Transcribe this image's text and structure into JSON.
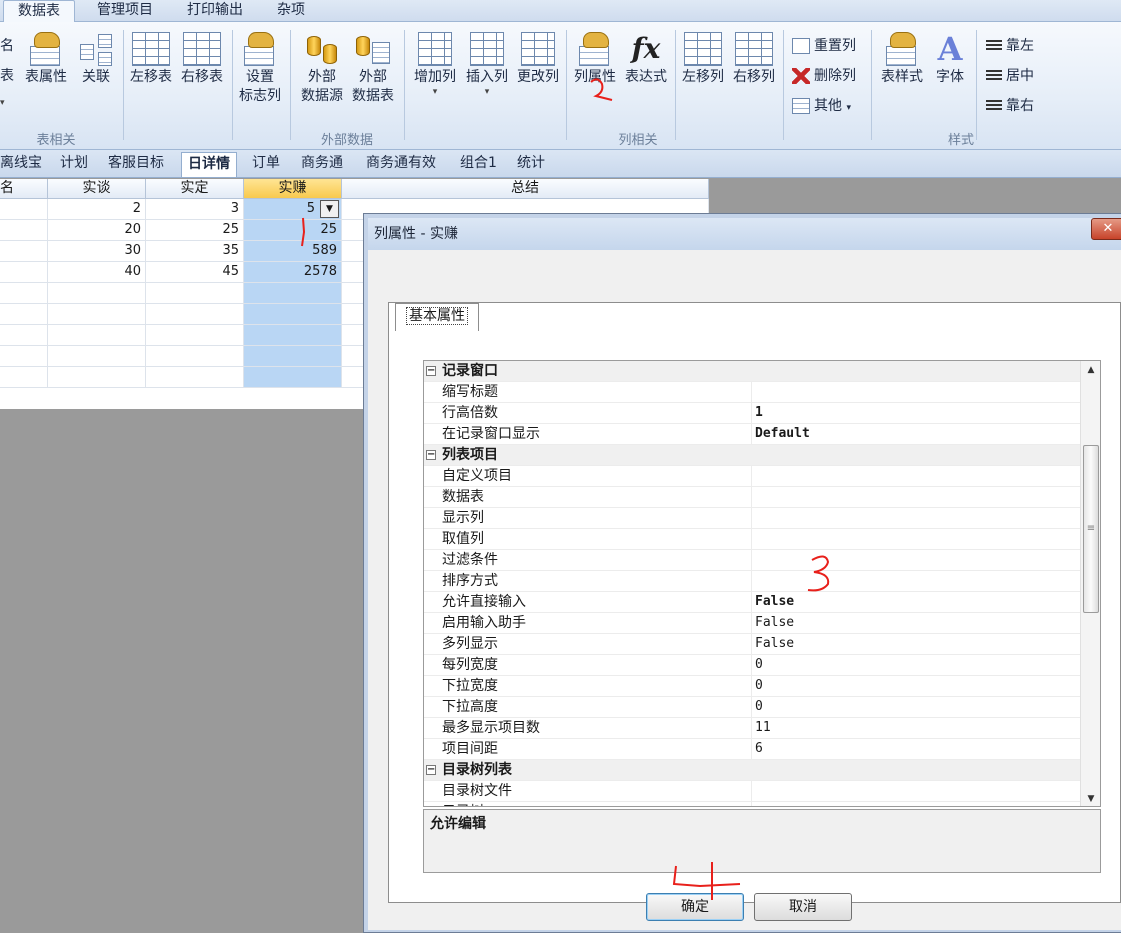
{
  "ribbon_tabs": [
    {
      "label": "数据表",
      "active": true
    },
    {
      "label": "管理项目",
      "active": false
    },
    {
      "label": "打印输出",
      "active": false
    },
    {
      "label": "杂项",
      "active": false
    }
  ],
  "ribbon": {
    "table_group": {
      "truncated_top": "名",
      "truncated_mid": "表",
      "props": "表属性",
      "link": "关联",
      "move_left": "左移表",
      "move_right": "右移表",
      "set_line1": "设置",
      "set_line2": "标志列",
      "label": "表相关"
    },
    "external_group": {
      "ext_src_line1": "外部",
      "ext_src_line2": "数据源",
      "ext_tbl_line1": "外部",
      "ext_tbl_line2": "数据表",
      "label": "外部数据"
    },
    "column_group": {
      "add_col": "增加列",
      "insert_col": "插入列",
      "change_col": "更改列",
      "col_props": "列属性",
      "expression": "表达式",
      "move_left": "左移列",
      "move_right": "右移列",
      "reset_col": "重置列",
      "delete_col": "删除列",
      "other": "其他",
      "label": "列相关"
    },
    "style_group": {
      "table_style": "表样式",
      "font": "字体",
      "align_left": "靠左",
      "align_center": "居中",
      "align_right": "靠右",
      "label": "样式"
    }
  },
  "sheet_tabs": [
    {
      "label": "离线宝",
      "active": false
    },
    {
      "label": "计划",
      "active": false
    },
    {
      "label": "客服目标",
      "active": false
    },
    {
      "label": "日详情",
      "active": true
    },
    {
      "label": "订单",
      "active": false
    },
    {
      "label": "商务通",
      "active": false
    },
    {
      "label": "商务通有效",
      "active": false
    },
    {
      "label": "组合1",
      "active": false
    },
    {
      "label": "统计",
      "active": false
    }
  ],
  "grid": {
    "headers": [
      "名",
      "实谈",
      "实定",
      "实赚",
      "总结"
    ],
    "rows": [
      [
        "",
        "2",
        "3",
        "5",
        ""
      ],
      [
        "",
        "20",
        "25",
        "25",
        ""
      ],
      [
        "",
        "30",
        "35",
        "589",
        ""
      ],
      [
        "",
        "40",
        "45",
        "2578",
        ""
      ],
      [
        "",
        "",
        "",
        "",
        ""
      ],
      [
        "",
        "",
        "",
        "",
        ""
      ],
      [
        "",
        "",
        "",
        "",
        ""
      ],
      [
        "",
        "",
        "",
        "",
        ""
      ],
      [
        "",
        "",
        "",
        "",
        ""
      ]
    ]
  },
  "dialog": {
    "title": "列属性 - 实赚",
    "tab": "基本属性",
    "properties": [
      {
        "type": "category",
        "name": "记录窗口",
        "value": ""
      },
      {
        "type": "item",
        "name": "缩写标题",
        "value": "",
        "bold": false
      },
      {
        "type": "item",
        "name": "行高倍数",
        "value": "1",
        "bold": true
      },
      {
        "type": "item",
        "name": "在记录窗口显示",
        "value": "Default",
        "bold": true
      },
      {
        "type": "category",
        "name": "列表项目",
        "value": ""
      },
      {
        "type": "item",
        "name": "自定义项目",
        "value": "",
        "bold": false
      },
      {
        "type": "item",
        "name": "数据表",
        "value": "",
        "bold": false
      },
      {
        "type": "item",
        "name": "显示列",
        "value": "",
        "bold": false
      },
      {
        "type": "item",
        "name": "取值列",
        "value": "",
        "bold": false
      },
      {
        "type": "item",
        "name": "过滤条件",
        "value": "",
        "bold": false
      },
      {
        "type": "item",
        "name": "排序方式",
        "value": "",
        "bold": false
      },
      {
        "type": "item",
        "name": "允许直接输入",
        "value": "False",
        "bold": true
      },
      {
        "type": "item",
        "name": "启用输入助手",
        "value": "False",
        "bold": false
      },
      {
        "type": "item",
        "name": "多列显示",
        "value": "False",
        "bold": false
      },
      {
        "type": "item",
        "name": "每列宽度",
        "value": "0",
        "bold": false
      },
      {
        "type": "item",
        "name": "下拉宽度",
        "value": "0",
        "bold": false
      },
      {
        "type": "item",
        "name": "下拉高度",
        "value": "0",
        "bold": false
      },
      {
        "type": "item",
        "name": "最多显示项目数",
        "value": "11",
        "bold": false
      },
      {
        "type": "item",
        "name": "项目间距",
        "value": "6",
        "bold": false
      },
      {
        "type": "category",
        "name": "目录树列表",
        "value": ""
      },
      {
        "type": "item",
        "name": "目录树文件",
        "value": "",
        "bold": false
      },
      {
        "type": "item",
        "name": "目录树…",
        "value": "",
        "bold": false
      }
    ],
    "description": "允许编辑",
    "ok": "确定",
    "cancel": "取消"
  },
  "annotations": {
    "color": "#e8201b",
    "marks": [
      "1",
      "2",
      "3",
      "4"
    ]
  }
}
